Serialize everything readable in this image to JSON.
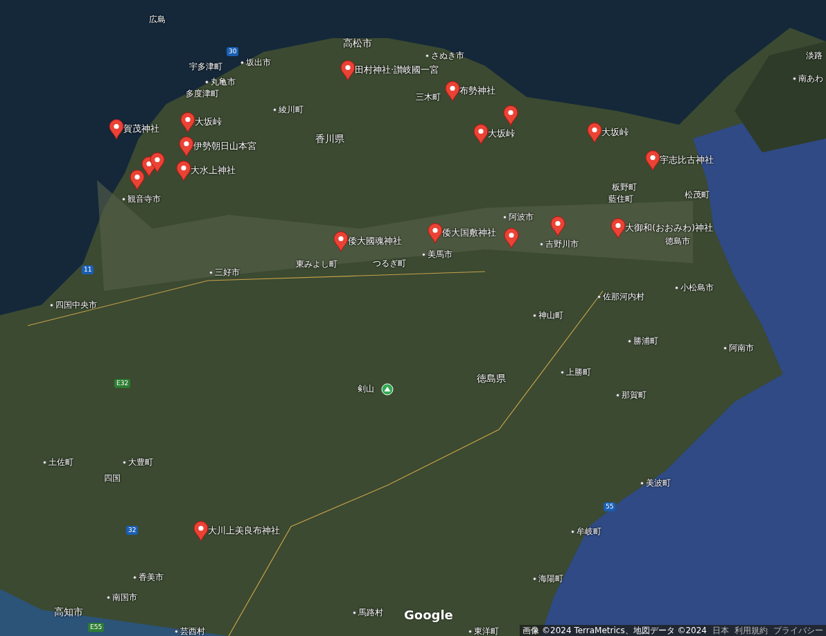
{
  "map": {
    "pins": [
      {
        "kind": "labeled",
        "label": "田村神社·讃岐國一宮"
      },
      {
        "kind": "labeled",
        "label": "布勢神社"
      },
      {
        "kind": "plain"
      },
      {
        "kind": "labeled",
        "label": "大坂峠"
      },
      {
        "kind": "labeled",
        "label": "大坂峠"
      },
      {
        "kind": "labeled",
        "label": "宇志比古神社"
      },
      {
        "kind": "labeled",
        "label": "賀茂神社"
      },
      {
        "kind": "labeled",
        "label": "大坂峠"
      },
      {
        "kind": "labeled",
        "label": "伊勢朝日山本宮"
      },
      {
        "kind": "plain"
      },
      {
        "kind": "plain"
      },
      {
        "kind": "labeled",
        "label": "大水上神社"
      },
      {
        "kind": "plain"
      },
      {
        "kind": "labeled",
        "label": "倭大国敷神社"
      },
      {
        "kind": "labeled",
        "label": "倭大國魂神社"
      },
      {
        "kind": "plain"
      },
      {
        "kind": "plain"
      },
      {
        "kind": "labeled",
        "label": "大御和(おおみわ)神社"
      },
      {
        "kind": "labeled",
        "label": "大川上美良布神社"
      }
    ],
    "places": [
      {
        "label": "広島",
        "kind": "plain"
      },
      {
        "label": "高松市",
        "kind": "city"
      },
      {
        "label": "さぬき市",
        "kind": "dot"
      },
      {
        "label": "坂出市",
        "kind": "dot"
      },
      {
        "label": "宇多津町",
        "kind": "plain"
      },
      {
        "label": "丸亀市",
        "kind": "dot"
      },
      {
        "label": "多度津町",
        "kind": "plain"
      },
      {
        "label": "三木町",
        "kind": "plain"
      },
      {
        "label": "綾川町",
        "kind": "dot"
      },
      {
        "label": "香川県",
        "kind": "city"
      },
      {
        "label": "観音寺市",
        "kind": "dot"
      },
      {
        "label": "板野町",
        "kind": "plain"
      },
      {
        "label": "藍住町",
        "kind": "plain"
      },
      {
        "label": "松茂町",
        "kind": "plain"
      },
      {
        "label": "阿波市",
        "kind": "dot"
      },
      {
        "label": "徳島市",
        "kind": "plain"
      },
      {
        "label": "吉野川市",
        "kind": "dot"
      },
      {
        "label": "美馬市",
        "kind": "dot"
      },
      {
        "label": "つるぎ町",
        "kind": "plain"
      },
      {
        "label": "東みよし町",
        "kind": "plain"
      },
      {
        "label": "三好市",
        "kind": "dot"
      },
      {
        "label": "四国中央市",
        "kind": "dot"
      },
      {
        "label": "小松島市",
        "kind": "dot"
      },
      {
        "label": "佐那河内村",
        "kind": "dot"
      },
      {
        "label": "神山町",
        "kind": "dot"
      },
      {
        "label": "勝浦町",
        "kind": "dot"
      },
      {
        "label": "阿南市",
        "kind": "dot"
      },
      {
        "label": "上勝町",
        "kind": "dot"
      },
      {
        "label": "徳島県",
        "kind": "city"
      },
      {
        "label": "剣山",
        "kind": "peak"
      },
      {
        "label": "那賀町",
        "kind": "dot"
      },
      {
        "label": "美波町",
        "kind": "dot"
      },
      {
        "label": "牟岐町",
        "kind": "dot"
      },
      {
        "label": "海陽町",
        "kind": "dot"
      },
      {
        "label": "土佐町",
        "kind": "dot"
      },
      {
        "label": "四国",
        "kind": "plain"
      },
      {
        "label": "大豊町",
        "kind": "dot"
      },
      {
        "label": "香美市",
        "kind": "dot"
      },
      {
        "label": "南国市",
        "kind": "dot"
      },
      {
        "label": "高知市",
        "kind": "city"
      },
      {
        "label": "馬路村",
        "kind": "dot"
      },
      {
        "label": "芸西村",
        "kind": "dot"
      },
      {
        "label": "東洋町",
        "kind": "dot"
      },
      {
        "label": "淡路",
        "kind": "plain"
      },
      {
        "label": "南あわ",
        "kind": "dot"
      }
    ],
    "road_shields": [
      {
        "label": "30",
        "kind": "national"
      },
      {
        "label": "11",
        "kind": "national"
      },
      {
        "label": "E32",
        "kind": "expressway"
      },
      {
        "label": "32",
        "kind": "national"
      },
      {
        "label": "55",
        "kind": "national"
      },
      {
        "label": "E55",
        "kind": "expressway"
      }
    ]
  },
  "logo": "Google",
  "attribution": {
    "text": "画像 ©2024 TerraMetrics、地図データ ©2024",
    "links": [
      "日本",
      "利用規約",
      "プライバシー"
    ]
  }
}
